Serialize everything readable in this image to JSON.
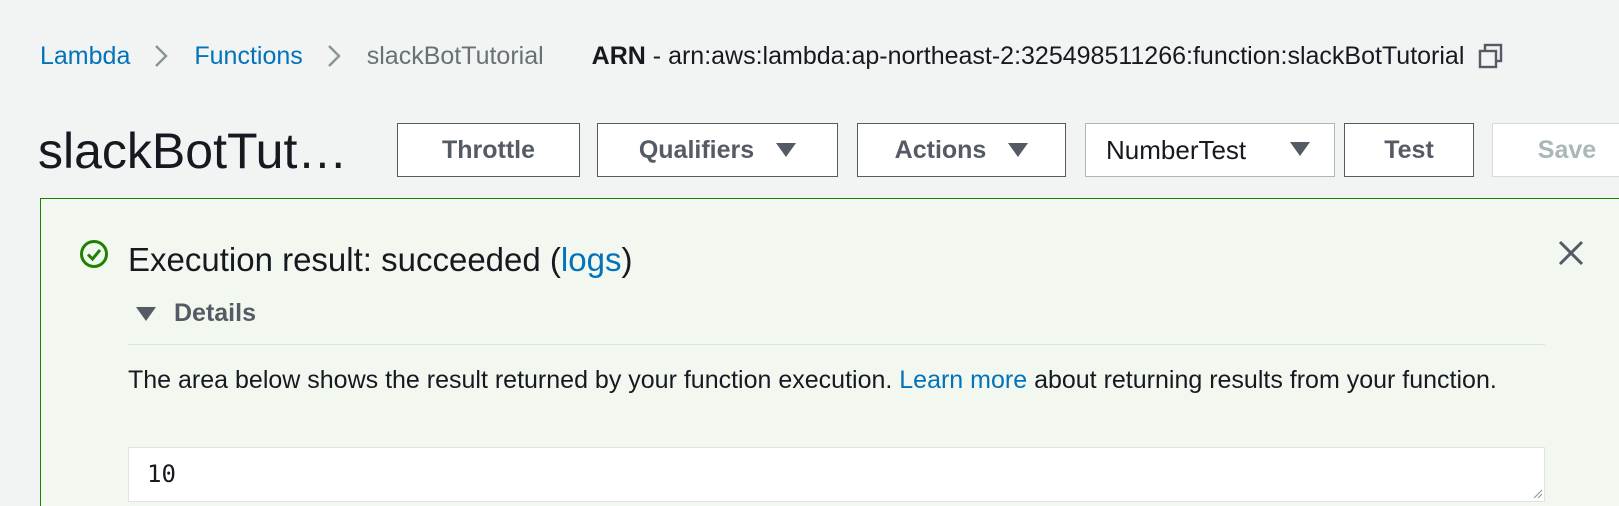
{
  "breadcrumb": {
    "items": [
      {
        "label": "Lambda"
      },
      {
        "label": "Functions"
      },
      {
        "label": "slackBotTutorial"
      }
    ],
    "arn_label": "ARN",
    "arn_separator": " - ",
    "arn_value": "arn:aws:lambda:ap-northeast-2:325498511266:function:slackBotTutorial"
  },
  "header": {
    "title": "slackBotTut…"
  },
  "toolbar": {
    "throttle_label": "Throttle",
    "qualifiers_label": "Qualifiers",
    "actions_label": "Actions",
    "test_event_selected": "NumberTest",
    "test_label": "Test",
    "save_label": "Save"
  },
  "result": {
    "heading_prefix": "Execution result: succeeded (",
    "logs_link": "logs",
    "heading_suffix": ")",
    "details_label": "Details",
    "description_prefix": "The area below shows the result returned by your function execution. ",
    "learn_more_link": "Learn more",
    "description_suffix": " about returning results from your function.",
    "output_value": "10"
  },
  "colors": {
    "link": "#0073bb",
    "success": "#1d8102",
    "panel_background": "#f2f8f0",
    "page_background": "#f2f3f3"
  },
  "icons": {
    "breadcrumb_separator": "chevron-right-icon",
    "copy": "copy-icon",
    "dropdown": "caret-down-icon",
    "success": "check-circle-icon",
    "close": "close-icon",
    "details_toggle": "triangle-down-icon"
  }
}
